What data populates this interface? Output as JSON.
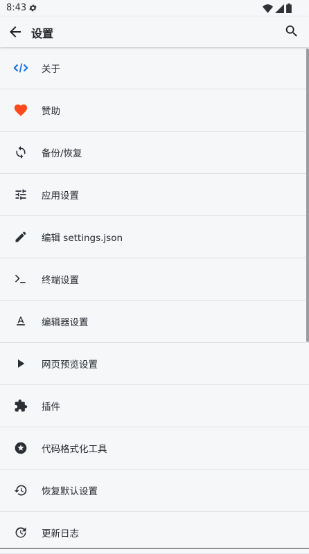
{
  "status_bar": {
    "time": "8:43"
  },
  "app_bar": {
    "title": "设置"
  },
  "colors": {
    "accent_blue": "#1a73e8",
    "heart_red": "#ff4a1c",
    "icon_dark": "#2b2e33"
  },
  "settings": [
    {
      "label": "关于",
      "icon": "code-icon"
    },
    {
      "label": "赞助",
      "icon": "heart-icon"
    },
    {
      "label": "备份/恢复",
      "icon": "sync-icon"
    },
    {
      "label": "应用设置",
      "icon": "tune-icon"
    },
    {
      "label": "编辑 settings.json",
      "icon": "pencil-icon"
    },
    {
      "label": "终端设置",
      "icon": "terminal-icon"
    },
    {
      "label": "编辑器设置",
      "icon": "text-format-icon"
    },
    {
      "label": "网页预览设置",
      "icon": "play-icon"
    },
    {
      "label": "插件",
      "icon": "puzzle-icon"
    },
    {
      "label": "代码格式化工具",
      "icon": "star-circle-icon"
    },
    {
      "label": "恢复默认设置",
      "icon": "history-icon"
    },
    {
      "label": "更新日志",
      "icon": "update-icon"
    }
  ]
}
